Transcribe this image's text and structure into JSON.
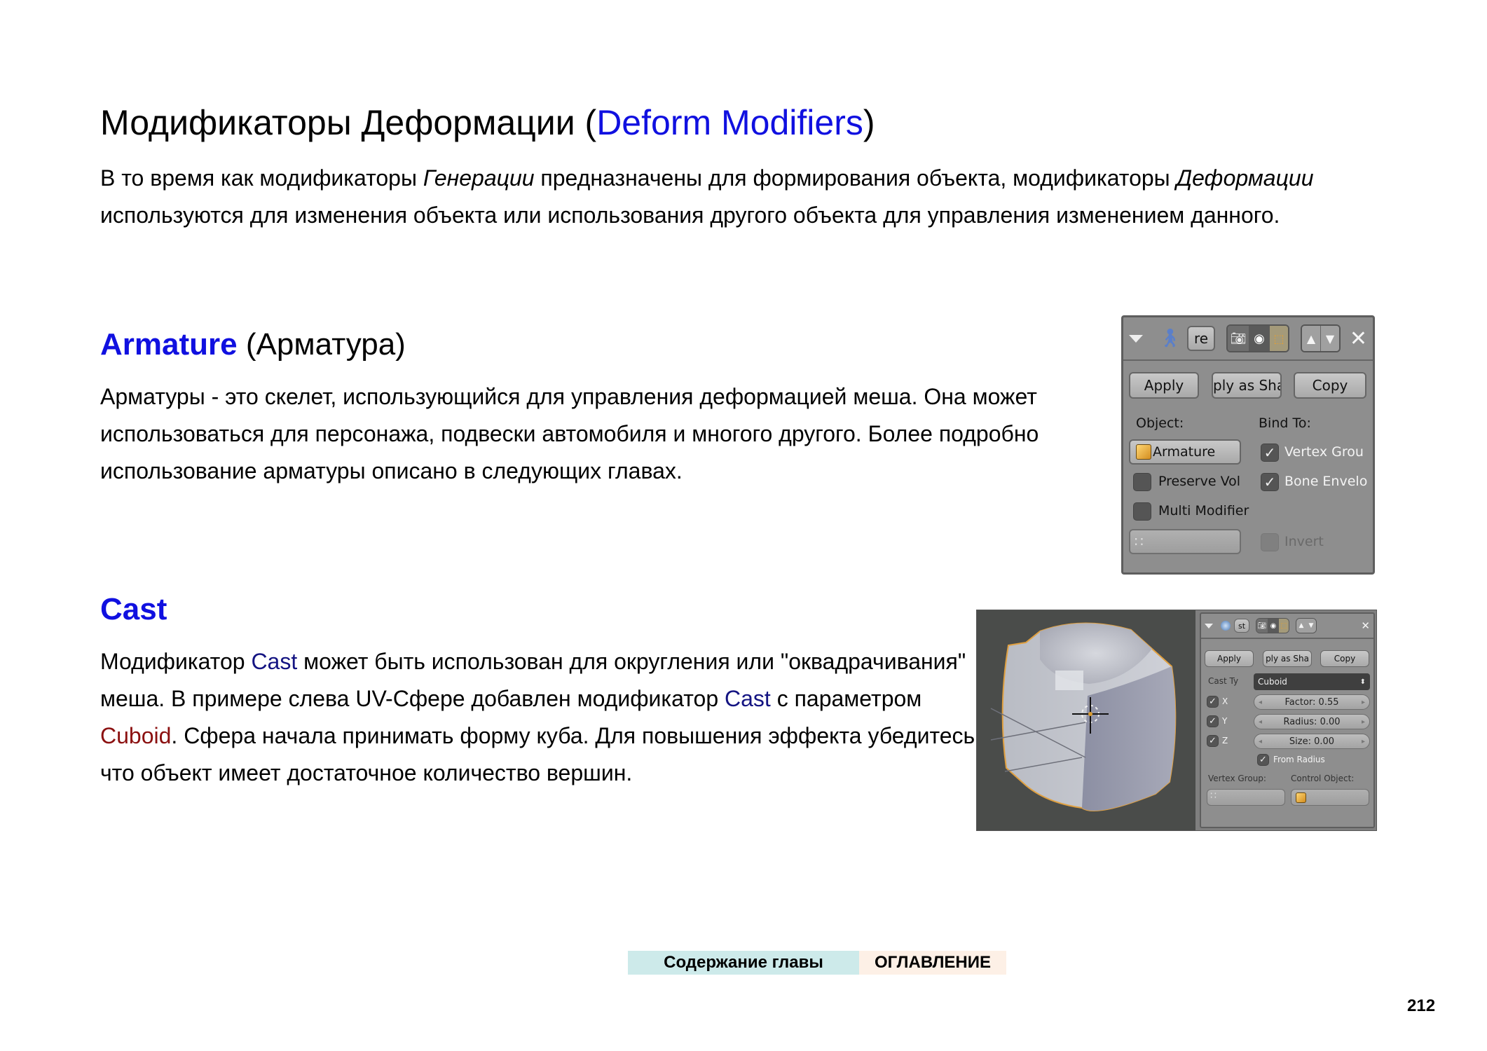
{
  "title": {
    "ru": "Модификаторы Деформации (",
    "en": "Deform Modifiers",
    "close": ")"
  },
  "intro": {
    "part1": "В то время как модификаторы ",
    "italic1": "Генерации",
    "part2": " предназначены для формирования объекта, модификаторы ",
    "italic2": "Деформации",
    "part3": " используются для изменения объекта или использования другого объекта для управления изменением данного."
  },
  "armature": {
    "heading_en": "Armature",
    "heading_ru": " (Арматура)",
    "text": "Арматуры - это скелет, использующийся для управления деформацией меша. Она может использоваться для персонажа, подвески автомобиля и многого другого. Более подробно использование арматуры описано в следующих главах.",
    "panel": {
      "name_field": "re",
      "buttons": [
        "Apply",
        "ply as Sha",
        "Copy"
      ],
      "object_label": "Object:",
      "bind_label": "Bind To:",
      "object_value": "Armature",
      "checkboxes": [
        {
          "label": "Vertex Grou",
          "checked": true
        },
        {
          "label": "Bone Envelo",
          "checked": true
        },
        {
          "label": "Preserve Vol",
          "checked": false
        },
        {
          "label": "Multi Modifier",
          "checked": false
        },
        {
          "label": "Invert",
          "checked": false
        }
      ],
      "icons": [
        "collapse-icon",
        "armature-icon",
        "render-icon",
        "view-icon",
        "editmode-icon",
        "move-up-icon",
        "move-down-icon",
        "close-icon"
      ]
    }
  },
  "cast": {
    "heading": "Cast",
    "text": {
      "p1": "Модификатор ",
      "cast1": "Cast",
      "p2": " может быть использован для округления или \"оквадрачивания\" меша. В примере слева UV-Сфере добавлен модификатор ",
      "cast2": "Cast",
      "p3": " с параметром ",
      "cuboid": "Cuboid",
      "p4": ". Сфера начала принимать форму куба. Для повышения эффекта убедитесь что объект имеет достаточное количество вершин."
    },
    "panel": {
      "name_field": "st",
      "buttons": [
        "Apply",
        "ply as Sha",
        "Copy"
      ],
      "cast_type_label": "Cast Ty",
      "cast_type_value": "Cuboid",
      "axes": [
        {
          "label": "X",
          "checked": true
        },
        {
          "label": "Y",
          "checked": true
        },
        {
          "label": "Z",
          "checked": true
        }
      ],
      "factor": "Factor: 0.55",
      "radius": "Radius: 0.00",
      "size": "Size: 0.00",
      "from_radius": {
        "label": "From Radius",
        "checked": true
      },
      "vertex_group_label": "Vertex Group:",
      "control_object_label": "Control Object:"
    }
  },
  "nav": {
    "chapter": "Содержание главы",
    "toc": "ОГЛАВЛЕНИЕ"
  },
  "page_number": "212",
  "colors": {
    "heading_blue": "#1010e0",
    "link_navy": "#141482",
    "param_red": "#8b1010",
    "nav_chapter_bg": "#cdeaea",
    "nav_toc_bg": "#fdf0e6"
  }
}
